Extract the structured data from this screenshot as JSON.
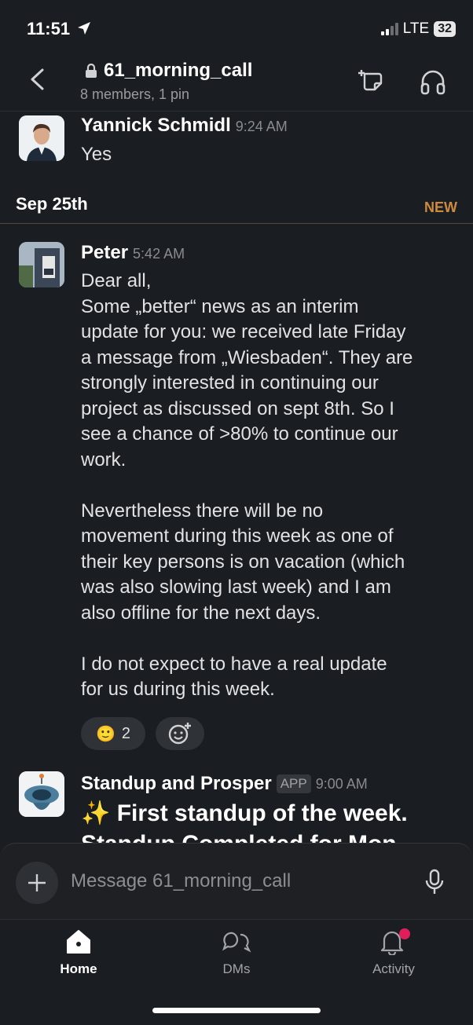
{
  "status": {
    "time": "11:51",
    "network": "LTE",
    "battery": "32"
  },
  "header": {
    "channel": "61_morning_call",
    "subtitle": "8 members, 1 pin"
  },
  "messages": [
    {
      "name": "Yannick Schmidl",
      "time": "9:24 AM",
      "text": "Yes"
    }
  ],
  "divider": {
    "date": "Sep 25th",
    "new_label": "NEW"
  },
  "peter": {
    "name": "Peter",
    "time": "5:42 AM",
    "lines": [
      "Dear all,",
      "Some „better“ news as an interim",
      "update for you: we received late Friday",
      "a message from „Wiesbaden“. They are",
      "strongly interested in continuing our",
      "project as discussed on sept 8th. So I",
      "see a chance of >80% to continue our",
      "work.",
      "",
      "Nevertheless there will be no",
      "movement during this week as one of",
      "their key persons is on vacation (which",
      "was also slowing last week) and I am",
      "also offline for the next days.",
      "",
      "I do not expect to have a real update",
      "for us during this week."
    ],
    "reaction": {
      "emoji": "🙂",
      "count": "2"
    }
  },
  "bot": {
    "name": "Standup and Prosper",
    "badge": "APP",
    "time": "9:00 AM",
    "line1": "✨ First standup of the week.",
    "line2": "Standup Completed for Mon"
  },
  "composer": {
    "placeholder": "Message 61_morning_call"
  },
  "tabs": {
    "home": "Home",
    "dms": "DMs",
    "activity": "Activity"
  },
  "colors": {
    "background": "#1a1d21",
    "new_accent": "#cd8b3f",
    "badge_red": "#e01e5a"
  }
}
